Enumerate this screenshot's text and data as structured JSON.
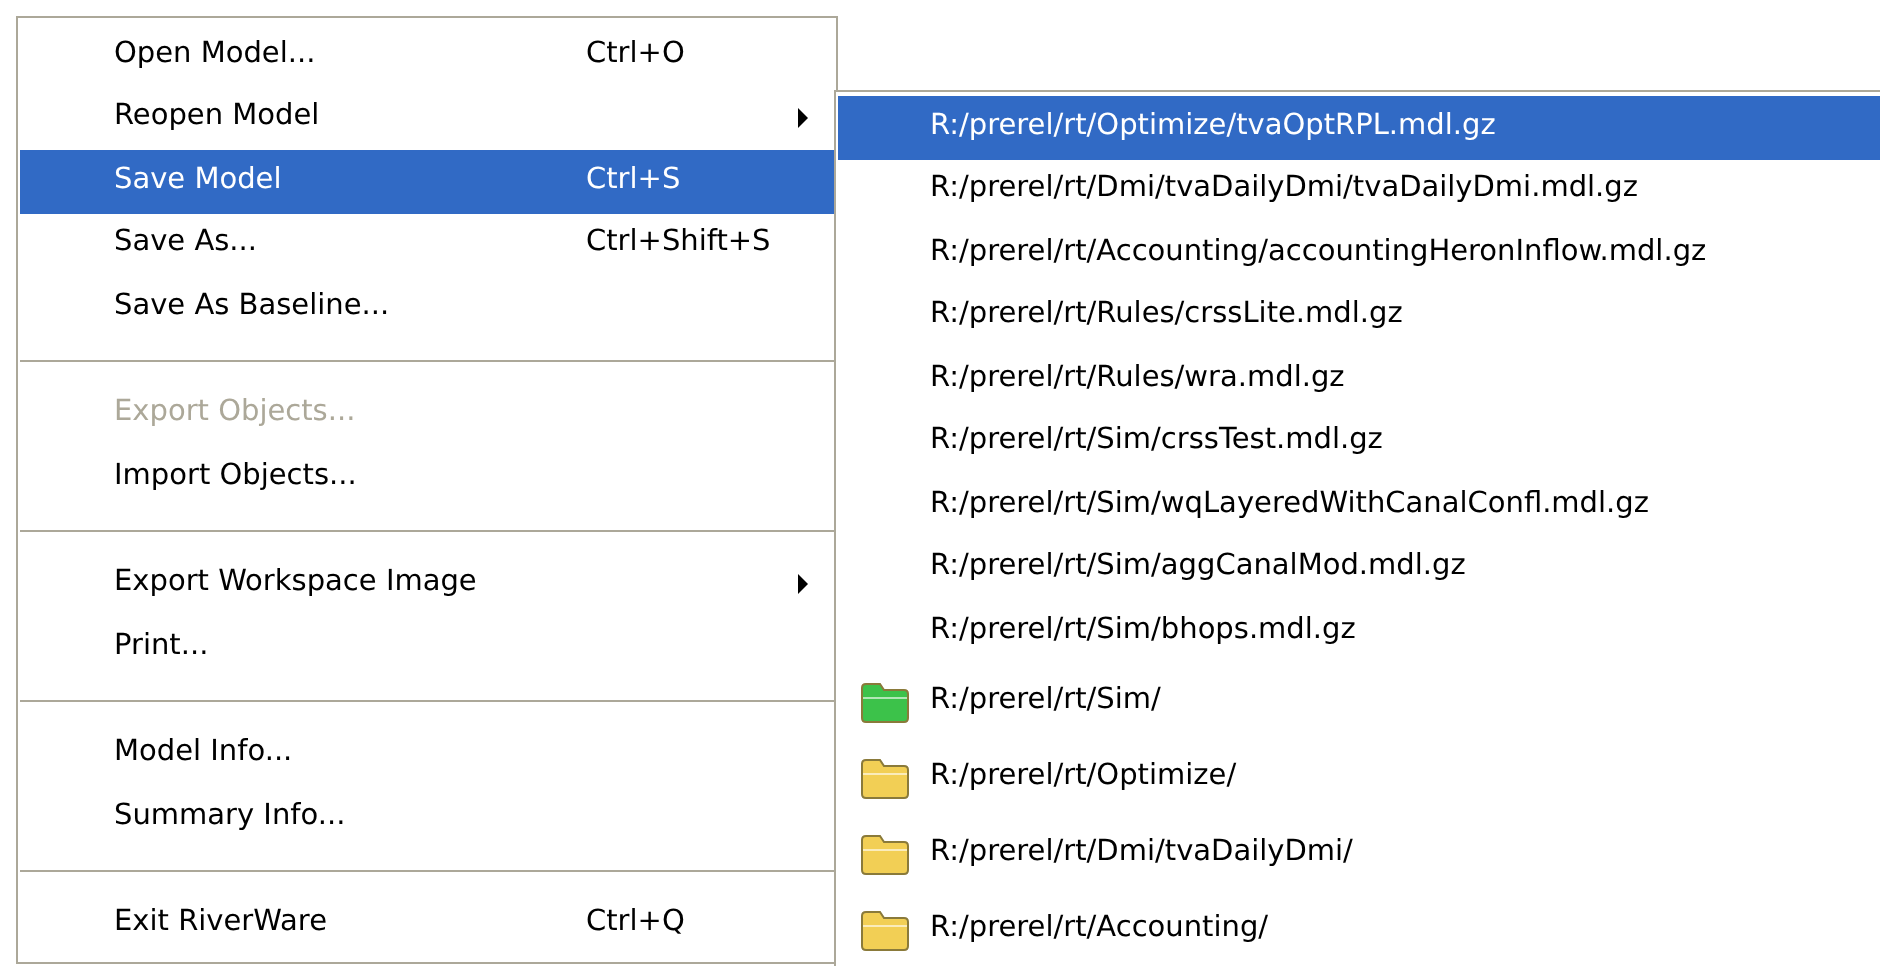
{
  "menu": {
    "items": [
      {
        "kind": "item",
        "label": "Open Model...",
        "shortcut": "Ctrl+O",
        "submenu": false,
        "disabled": false,
        "selected": false
      },
      {
        "kind": "item",
        "label": "Reopen Model",
        "submenu": true,
        "disabled": false,
        "selected": false
      },
      {
        "kind": "item",
        "label": "Save Model",
        "shortcut": "Ctrl+S",
        "submenu": false,
        "disabled": false,
        "selected": true
      },
      {
        "kind": "item",
        "label": "Save As...",
        "shortcut": "Ctrl+Shift+S",
        "submenu": false,
        "disabled": false,
        "selected": false
      },
      {
        "kind": "item",
        "label": "Save As Baseline...",
        "submenu": false,
        "disabled": false,
        "selected": false
      },
      {
        "kind": "separator"
      },
      {
        "kind": "item",
        "label": "Export Objects...",
        "submenu": false,
        "disabled": true,
        "selected": false
      },
      {
        "kind": "item",
        "label": "Import Objects...",
        "submenu": false,
        "disabled": false,
        "selected": false
      },
      {
        "kind": "separator"
      },
      {
        "kind": "item",
        "label": "Export Workspace Image",
        "submenu": true,
        "disabled": false,
        "selected": false
      },
      {
        "kind": "item",
        "label": "Print...",
        "submenu": false,
        "disabled": false,
        "selected": false
      },
      {
        "kind": "separator"
      },
      {
        "kind": "item",
        "label": "Model Info...",
        "submenu": false,
        "disabled": false,
        "selected": false
      },
      {
        "kind": "item",
        "label": "Summary Info...",
        "submenu": false,
        "disabled": false,
        "selected": false
      },
      {
        "kind": "separator"
      },
      {
        "kind": "item",
        "label": "Exit RiverWare",
        "shortcut": "Ctrl+Q",
        "submenu": false,
        "disabled": false,
        "selected": false
      }
    ]
  },
  "submenu": {
    "items": [
      {
        "kind": "file",
        "label": "R:/prerel/rt/Optimize/tvaOptRPL.mdl.gz",
        "selected": true
      },
      {
        "kind": "file",
        "label": "R:/prerel/rt/Dmi/tvaDailyDmi/tvaDailyDmi.mdl.gz",
        "selected": false
      },
      {
        "kind": "file",
        "label": "R:/prerel/rt/Accounting/accountingHeronInflow.mdl.gz",
        "selected": false
      },
      {
        "kind": "file",
        "label": "R:/prerel/rt/Rules/crssLite.mdl.gz",
        "selected": false
      },
      {
        "kind": "file",
        "label": "R:/prerel/rt/Rules/wra.mdl.gz",
        "selected": false
      },
      {
        "kind": "file",
        "label": "R:/prerel/rt/Sim/crssTest.mdl.gz",
        "selected": false
      },
      {
        "kind": "file",
        "label": "R:/prerel/rt/Sim/wqLayeredWithCanalConfl.mdl.gz",
        "selected": false
      },
      {
        "kind": "file",
        "label": "R:/prerel/rt/Sim/aggCanalMod.mdl.gz",
        "selected": false
      },
      {
        "kind": "file",
        "label": "R:/prerel/rt/Sim/bhops.mdl.gz",
        "selected": false
      },
      {
        "kind": "folder",
        "label": "R:/prerel/rt/Sim/",
        "color": "#3cc24a",
        "selected": false
      },
      {
        "kind": "folder",
        "label": "R:/prerel/rt/Optimize/",
        "color": "#f2cf55",
        "selected": false
      },
      {
        "kind": "folder",
        "label": "R:/prerel/rt/Dmi/tvaDailyDmi/",
        "color": "#f2cf55",
        "selected": false
      },
      {
        "kind": "folder",
        "label": "R:/prerel/rt/Accounting/",
        "color": "#f2cf55",
        "selected": false
      }
    ]
  }
}
